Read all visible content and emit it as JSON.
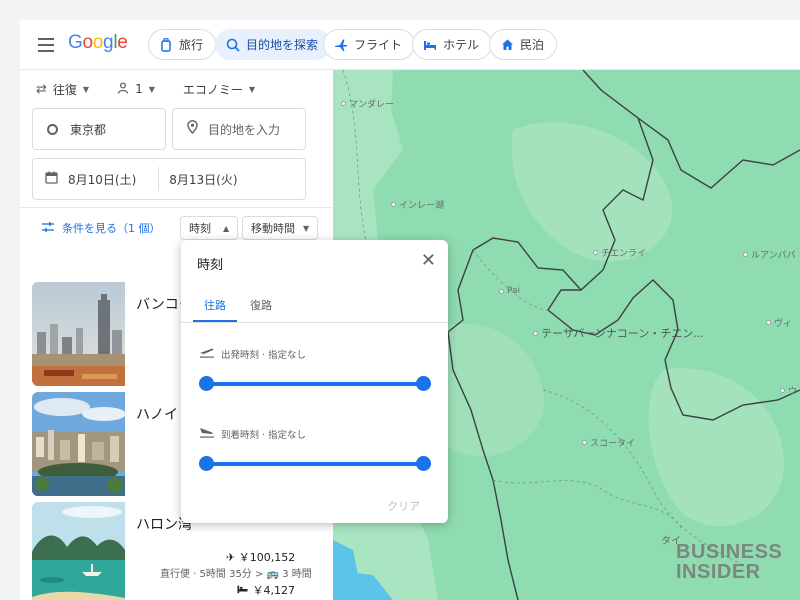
{
  "header": {
    "logo_text": "Google",
    "chips": [
      {
        "label": "旅行",
        "icon": "luggage-icon",
        "active": false
      },
      {
        "label": "目的地を探索",
        "icon": "explore-icon",
        "active": true
      },
      {
        "label": "フライト",
        "icon": "airplane-icon",
        "active": false
      },
      {
        "label": "ホテル",
        "icon": "bed-icon",
        "active": false
      },
      {
        "label": "民泊",
        "icon": "house-icon",
        "active": false
      }
    ]
  },
  "search": {
    "trip_type": "往復",
    "passengers": "1",
    "cabin": "エコノミー",
    "origin": "東京都",
    "destination_placeholder": "目的地を入力",
    "depart_date": "8月10日(土)",
    "return_date": "8月13日(火)"
  },
  "filters": {
    "view_filters": "条件を見る（1 個）",
    "time": "時刻",
    "duration": "移動時間"
  },
  "destinations": [
    {
      "name": "バンコク"
    },
    {
      "name": "ハノイ"
    },
    {
      "name": "ハロン湾",
      "flight_price": "￥100,152",
      "flight_info": "直行便 · 5時間 35分 >",
      "hotel_info": "3 時間",
      "hotel_price": "￥4,127"
    }
  ],
  "popup": {
    "title": "時刻",
    "tabs": [
      "往路",
      "復路"
    ],
    "departure_label": "出発時刻 · 指定なし",
    "arrival_label": "到着時刻 · 指定なし",
    "clear": "クリア"
  },
  "map": {
    "labels": [
      "マンダレー",
      "インレー湖",
      "チエンライ",
      "ルアンパバ",
      "Pai",
      "テーサバーンナコーン・チエン...",
      "ヴィ",
      "スコータイ",
      "ウ",
      "タイ"
    ]
  },
  "watermark": {
    "line1": "BUSINESS",
    "line2": "INSIDER"
  },
  "colors": {
    "accent": "#1a73e8",
    "map_land": "#8fdcb1",
    "map_sea": "#5bc4e8"
  }
}
